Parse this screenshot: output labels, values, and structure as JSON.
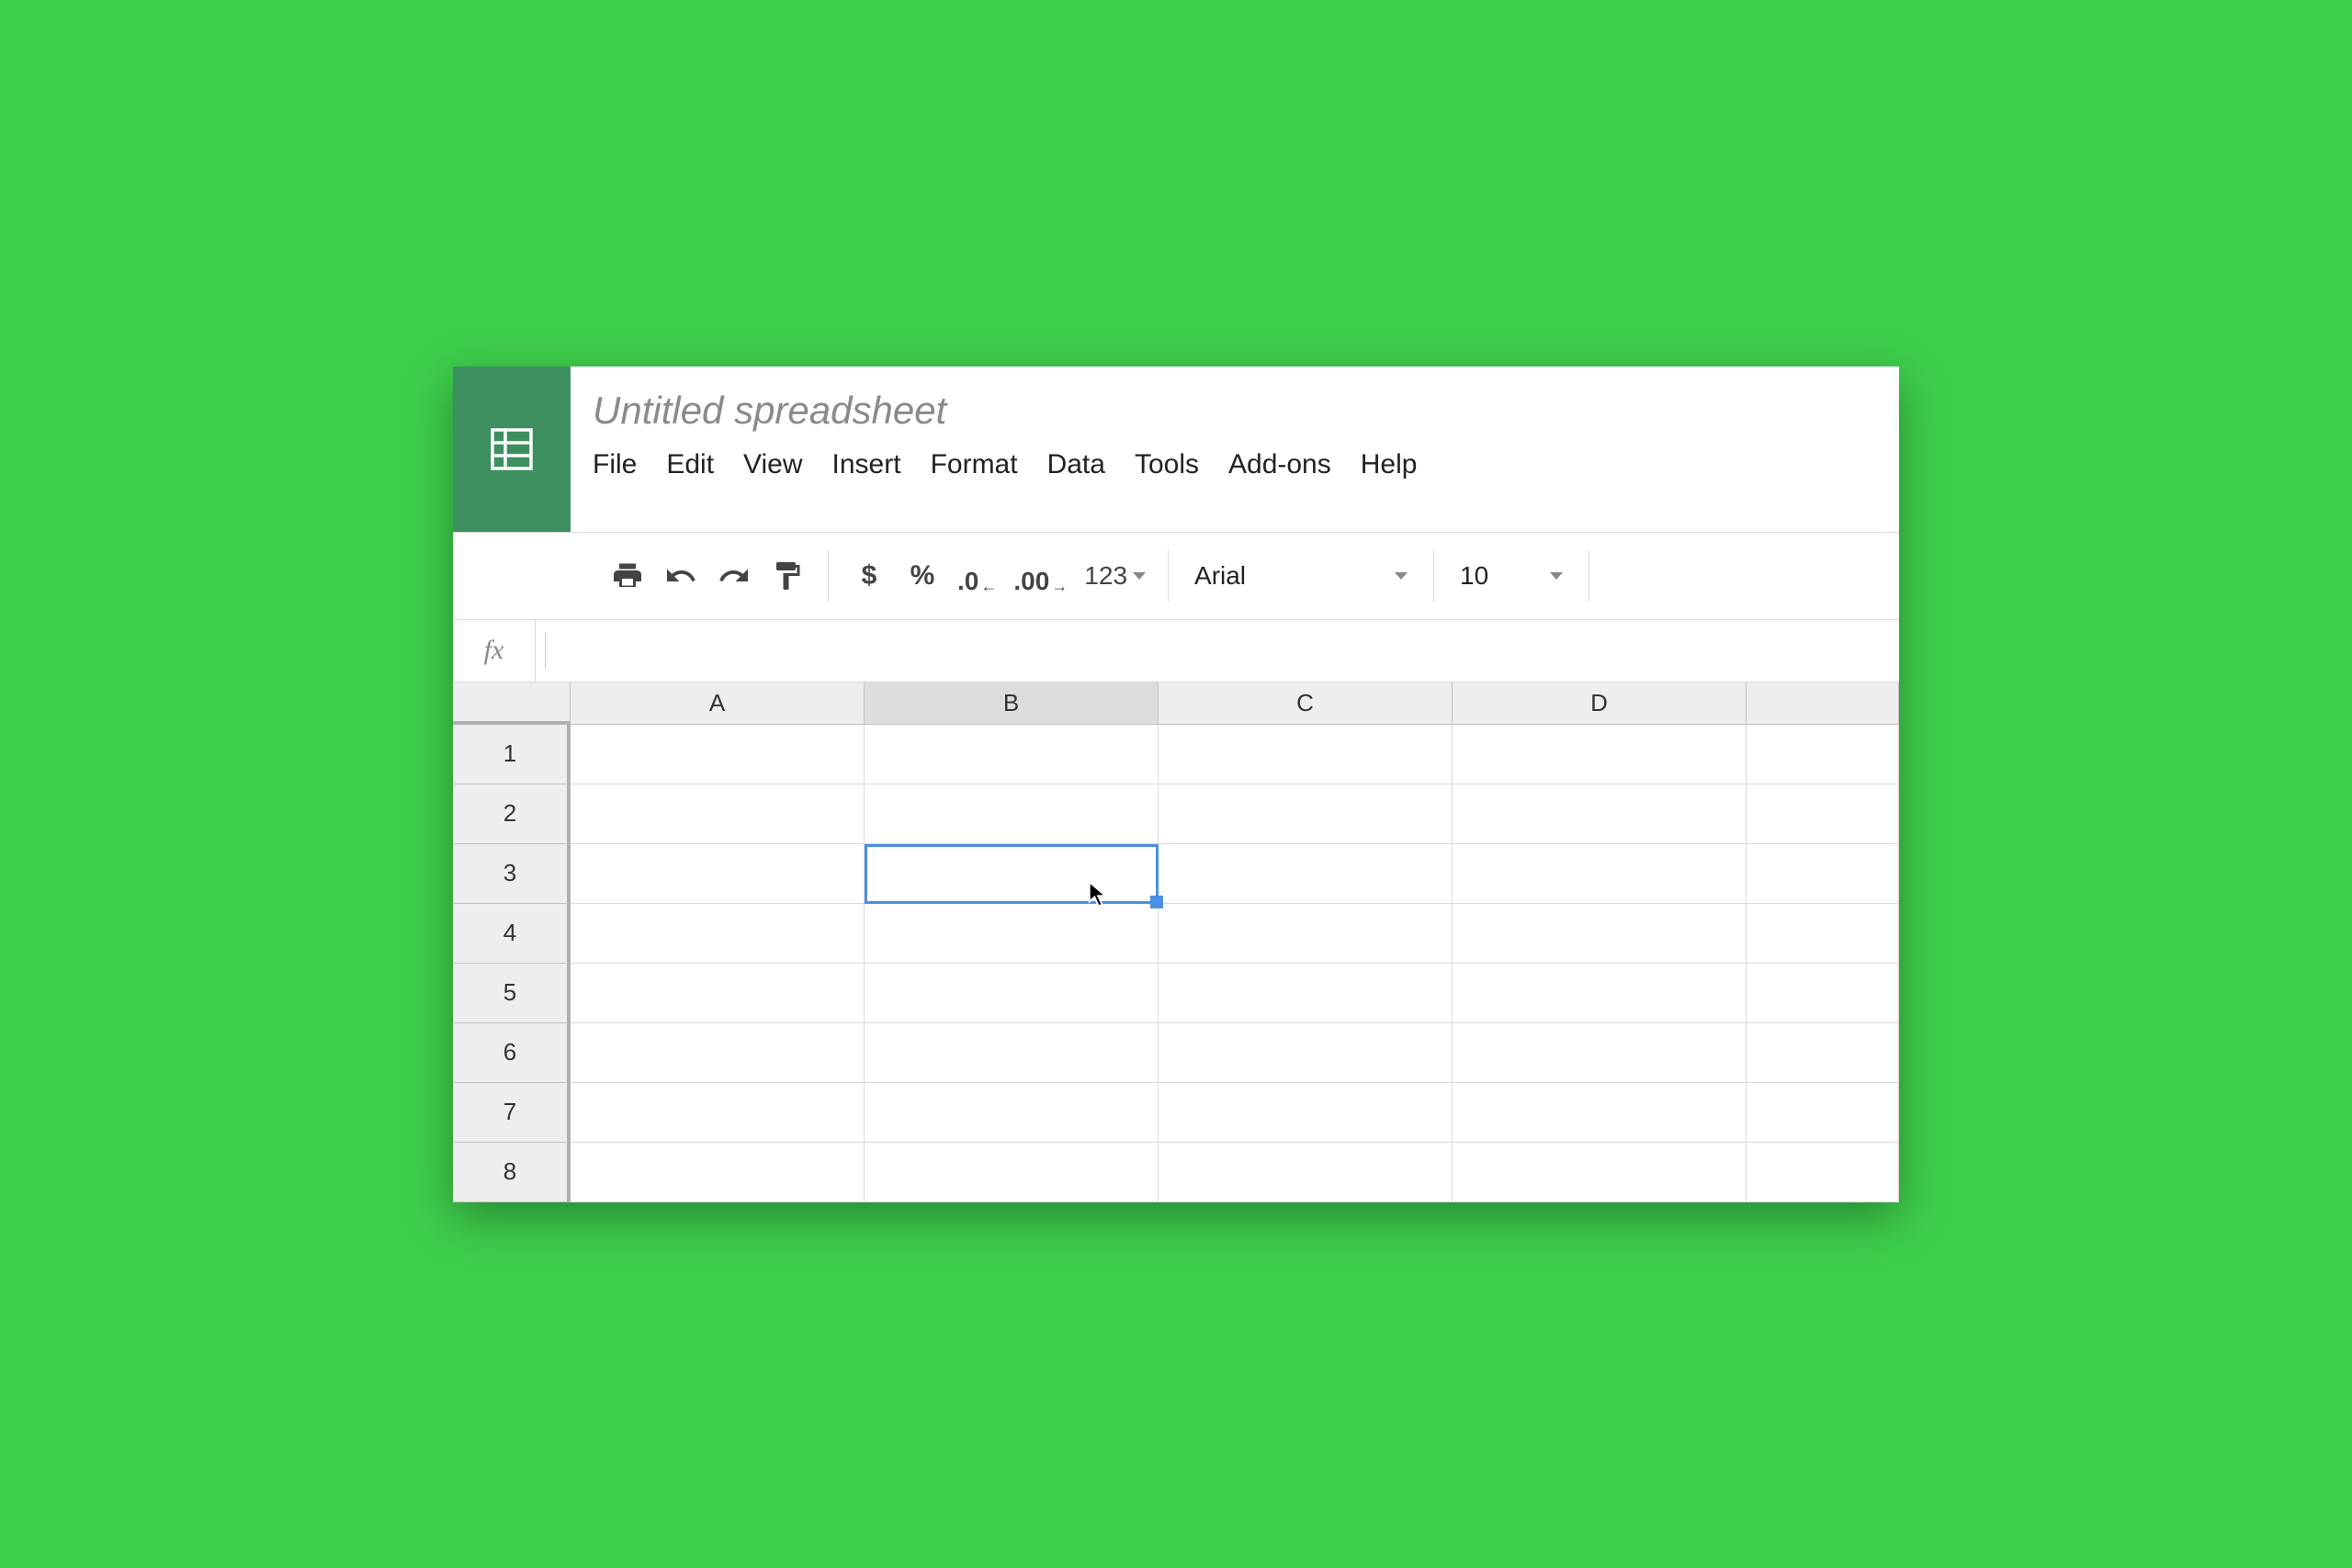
{
  "title": "Untitled spreadsheet",
  "menu": {
    "file": "File",
    "edit": "Edit",
    "view": "View",
    "insert": "Insert",
    "format": "Format",
    "data": "Data",
    "tools": "Tools",
    "addons": "Add-ons",
    "help": "Help"
  },
  "toolbar": {
    "currency": "$",
    "percent": "%",
    "dec_decrease": ".0",
    "dec_increase": ".00",
    "more_formats": "123",
    "font": "Arial",
    "font_size": "10"
  },
  "formula_bar": {
    "fx_label": "fx",
    "value": ""
  },
  "columns": [
    "A",
    "B",
    "C",
    "D"
  ],
  "rows": [
    "1",
    "2",
    "3",
    "4",
    "5",
    "6",
    "7",
    "8"
  ],
  "selected_cell": "B3",
  "selected_column": "B",
  "cells": {}
}
